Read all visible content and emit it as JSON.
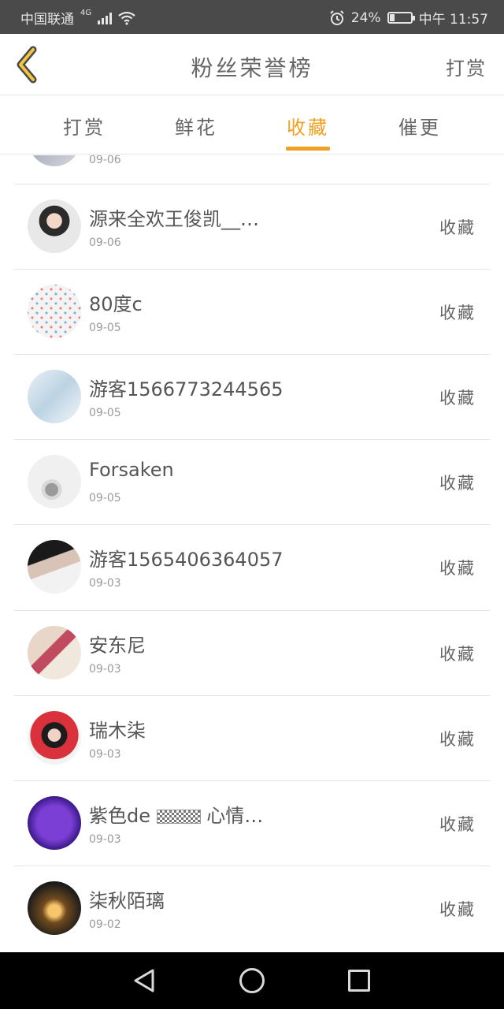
{
  "status_bar": {
    "carrier": "中国联通",
    "network": "4G",
    "battery_percent": "24%",
    "time": "中午 11:57",
    "battery_level": 0.24
  },
  "header": {
    "title": "粉丝荣誉榜",
    "right_label": "打赏"
  },
  "tabs": [
    {
      "label": "打赏"
    },
    {
      "label": "鲜花"
    },
    {
      "label": "收藏",
      "active": true
    },
    {
      "label": "催更"
    }
  ],
  "partial_item": {
    "date": "09-06"
  },
  "items": [
    {
      "name": "源来全欢王俊凯__…",
      "date": "09-06",
      "action": "收藏"
    },
    {
      "name": "80度c",
      "date": "09-05",
      "action": "收藏"
    },
    {
      "name": "游客1566773244565",
      "date": "09-05",
      "action": "收藏"
    },
    {
      "name": "Forsaken",
      "date": "09-05",
      "action": "收藏"
    },
    {
      "name": "游客1565406364057",
      "date": "09-03",
      "action": "收藏"
    },
    {
      "name": "安东尼",
      "date": "09-03",
      "action": "收藏"
    },
    {
      "name": "瑞木柒",
      "date": "09-03",
      "action": "收藏"
    },
    {
      "name_prefix": "紫色de",
      "name_suffix": "心情…",
      "date": "09-03",
      "action": "收藏"
    },
    {
      "name": "柒秋陌璃",
      "date": "09-02",
      "action": "收藏"
    }
  ],
  "colors": {
    "accent": "#f0a020",
    "status_bar": "#4a4a4a",
    "nav_bar": "#000000"
  }
}
